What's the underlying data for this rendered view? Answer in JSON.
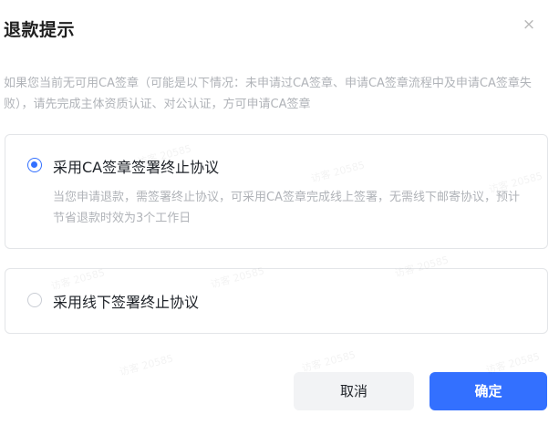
{
  "dialog": {
    "title": "退款提示",
    "close_icon": "×",
    "notice": "如果您当前无可用CA签章（可能是以下情况：未申请过CA签章、申请CA签章流程中及申请CA签章失败），请先完成主体资质认证、对公认证，方可申请CA签章"
  },
  "options": [
    {
      "label": "采用CA签章签署终止协议",
      "description": "当您申请退款，需签署终止协议，可采用CA签章完成线上签署，无需线下邮寄协议，预计节省退款时效为3个工作日",
      "selected": true
    },
    {
      "label": "采用线下签署终止协议",
      "selected": false
    }
  ],
  "buttons": {
    "cancel": "取消",
    "confirm": "确定"
  },
  "watermark": "访客 20585",
  "colors": {
    "accent": "#3370ff",
    "muted_text": "#b0b3b8"
  }
}
